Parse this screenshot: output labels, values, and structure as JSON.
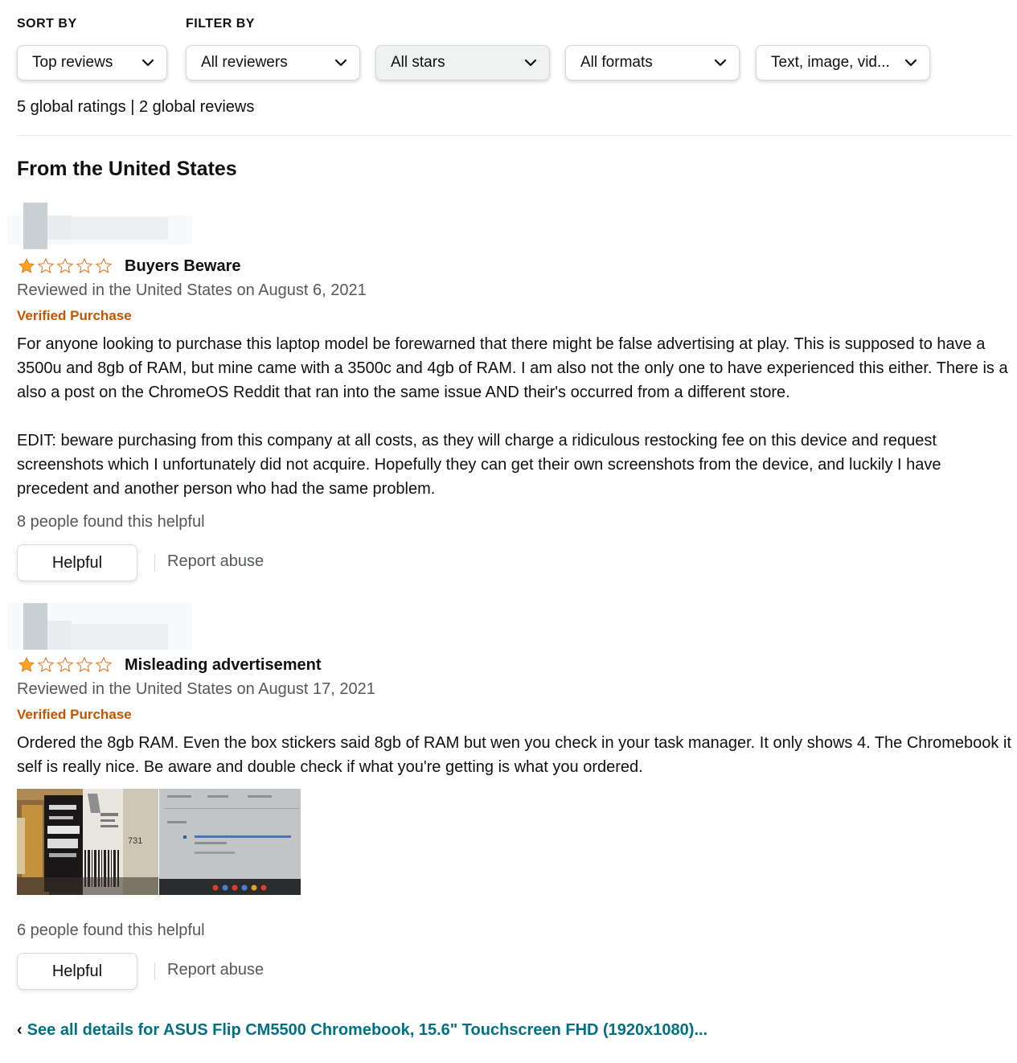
{
  "filters": {
    "sort_label": "SORT BY",
    "filter_label": "FILTER BY",
    "sort_value": "Top reviews",
    "reviewers_value": "All reviewers",
    "stars_value": "All stars",
    "formats_value": "All formats",
    "media_value": "Text, image, vid..."
  },
  "summary": "5 global ratings | 2 global reviews",
  "section_title": "From the United States",
  "reviews": [
    {
      "rating": 1,
      "rating_max": 5,
      "title": "Buyers Beware",
      "date": "Reviewed in the United States on August 6, 2021",
      "verified": "Verified Purchase",
      "paragraphs": [
        "For anyone looking to purchase this laptop model be forewarned that there might be false advertising at play. This is supposed to have a 3500u and 8gb of RAM, but mine came with a 3500c and 4gb of RAM. I am also not the only one to have experienced this either. There is a also a post on the ChromeOS Reddit that ran into the same issue AND their's occurred from a different store.",
        "EDIT: beware purchasing from this company at all costs, as they will charge a ridiculous restocking fee on this device and request screenshots which I unfortunately did not acquire. Hopefully they can get their own screenshots from the device, and luckily I have precedent and another person who had the same problem."
      ],
      "helpful_count_text": "8 people found this helpful",
      "helpful_button": "Helpful",
      "report_link": "Report abuse"
    },
    {
      "rating": 1,
      "rating_max": 5,
      "title": "Misleading advertisement",
      "date": "Reviewed in the United States on August 17, 2021",
      "verified": "Verified Purchase",
      "paragraphs": [
        "Ordered the 8gb RAM. Even the box stickers said 8gb of RAM but wen you check in your task manager. It only shows 4. The Chromebook it self is really nice. Be aware and double check if what you're getting is what you ordered."
      ],
      "images": [
        "box-sticker-photo",
        "task-manager-screen-photo"
      ],
      "image_text": "731",
      "helpful_count_text": "6 people found this helpful",
      "helpful_button": "Helpful",
      "report_link": "Report abuse"
    }
  ],
  "see_all_link": "See all details for ASUS Flip CM5500 Chromebook, 15.6\" Touchscreen FHD (1920x1080)...",
  "colors": {
    "star": "#ffa41c",
    "star_outline": "#de7921",
    "verified": "#c45500",
    "link": "#007185",
    "muted": "#565959"
  }
}
